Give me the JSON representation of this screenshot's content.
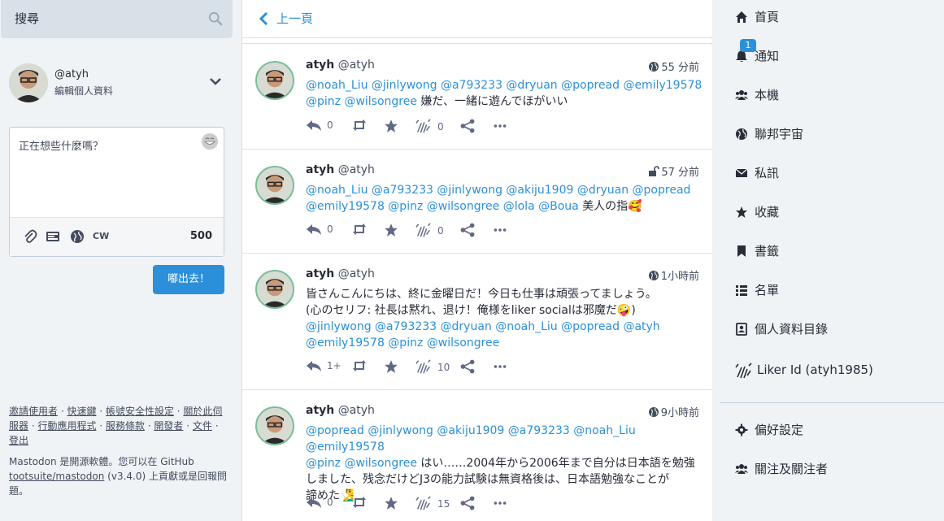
{
  "search": {
    "placeholder": "搜尋"
  },
  "profile": {
    "acct": "@atyh",
    "edit_label": "編輯個人資料"
  },
  "compose": {
    "placeholder": "正在想些什麼嗎？",
    "cw_label": "CW",
    "char_count": "500",
    "toot_button": "嘟出去！"
  },
  "footer": {
    "links": [
      "邀請使用者",
      "快速鍵",
      "帳號安全性設定",
      "關於此伺服器",
      "行動應用程式",
      "服務條款",
      "開發者",
      "文件",
      "登出"
    ],
    "about_prefix": "Mastodon 是開源軟體。您可以在 GitHub",
    "repo_link": "tootsuite/mastodon",
    "about_suffix": "(v3.4.0) 上貢獻或是回報問題。"
  },
  "column_header": {
    "back_label": "上一頁"
  },
  "statuses": [
    {
      "display_name": "atyh",
      "acct": "@atyh",
      "time": "55 分前",
      "visibility": "globe-icon",
      "mentions1": "@noah_Liu @jinlywong @a793233 @dryuan @popread @emily19578",
      "mentions2": "@pinz @wilsongree",
      "text_tail": " 嫌だ、一緒に遊んでほがいい",
      "replies": "0",
      "likes": "0"
    },
    {
      "display_name": "atyh",
      "acct": "@atyh",
      "time": "57 分前",
      "visibility": "unlock-icon",
      "mentions1": "@noah_Liu @a793233 @jinlywong @akiju1909 @dryuan @popread",
      "mentions2": "@emily19578 @pinz @wilsongree @lola @Boua",
      "text_tail": " 美人の指🥰",
      "replies": "0",
      "likes": "0"
    },
    {
      "display_name": "atyh",
      "acct": "@atyh",
      "time": "1小時前",
      "visibility": "globe-icon",
      "line1": "皆さんこんにちは、終に金曜日だ！今日も仕事は頑張ってましょう。",
      "line2": "(心のセリフ: 社長は黙れ、退け！俺様をliker socialは邪魔だ🤪)",
      "mentions1": "@jinlywong @a793233 @dryuan @noah_Liu @popread @atyh",
      "mentions2": "@emily19578 @pinz @wilsongree",
      "replies": "1+",
      "likes": "10"
    },
    {
      "display_name": "atyh",
      "acct": "@atyh",
      "time": "9小時前",
      "visibility": "globe-icon",
      "mentions1": "@popread @jinlywong @akiju1909 @a793233 @noah_Liu @emily19578",
      "mentions2": "@pinz @wilsongree",
      "text_tail": " はい……2004年から2006年まで自分は日本語を勉強",
      "line3": "しました、残念だけどJ3の能力試験は無資格後は、日本語勉強なことが",
      "line4": "諦めた🧏‍♂️",
      "replies": "0",
      "likes": "15"
    }
  ],
  "nav": {
    "items": [
      {
        "label": "首頁",
        "icon": "home-icon"
      },
      {
        "label": "通知",
        "icon": "bell-icon"
      },
      {
        "label": "本機",
        "icon": "users-icon"
      },
      {
        "label": "聯邦宇宙",
        "icon": "globe-icon"
      },
      {
        "label": "私訊",
        "icon": "envelope-icon"
      },
      {
        "label": "收藏",
        "icon": "star-icon"
      },
      {
        "label": "書籤",
        "icon": "bookmark-icon"
      },
      {
        "label": "名單",
        "icon": "list-icon"
      },
      {
        "label": "個人資料目錄",
        "icon": "address-book-icon"
      },
      {
        "label": "Liker Id (atyh1985)",
        "icon": "liker-clap-icon"
      },
      {
        "label": "偏好設定",
        "icon": "gear-icon"
      },
      {
        "label": "關注及關注者",
        "icon": "users-icon"
      }
    ],
    "notification_badge": "1"
  },
  "colors": {
    "accent": "#2b90d9",
    "text": "#282c37",
    "muted": "#606984",
    "bg": "#eff3f5"
  }
}
